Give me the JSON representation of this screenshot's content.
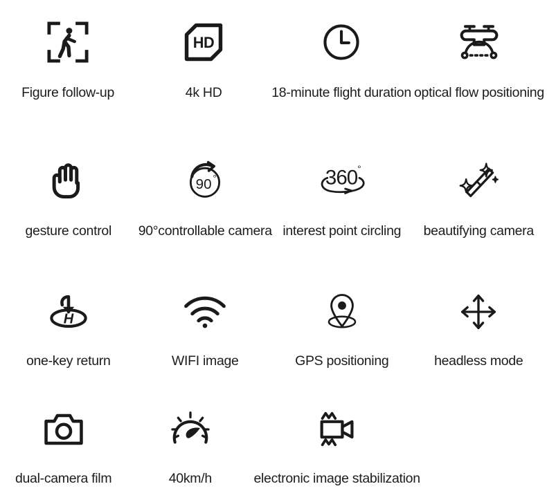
{
  "page": {
    "background_color": "#ffffff",
    "text_color": "#1c1c1c",
    "icon_color": "#1a1a1a",
    "columns": 4,
    "rows": 4
  },
  "rows": [
    {
      "items": [
        {
          "label": "Figure follow-up",
          "icon": "figure-follow-icon"
        },
        {
          "label": "4k HD",
          "icon": "hd-card-icon"
        },
        {
          "label": "18-minute flight duration",
          "icon": "clock-icon"
        },
        {
          "label": "optical flow positioning",
          "icon": "drone-optical-flow-icon"
        }
      ]
    },
    {
      "items": [
        {
          "label": "gesture control",
          "icon": "hand-icon"
        },
        {
          "label": "90°controllable camera",
          "icon": "ninety-degree-rotate-icon"
        },
        {
          "label": "interest point circling",
          "icon": "three-sixty-orbit-icon"
        },
        {
          "label": "beautifying camera",
          "icon": "magic-wand-sparkle-icon"
        }
      ]
    },
    {
      "items": [
        {
          "label": "one-key return",
          "icon": "return-to-home-icon"
        },
        {
          "label": "WIFI image",
          "icon": "wifi-icon"
        },
        {
          "label": "GPS positioning",
          "icon": "map-pin-icon"
        },
        {
          "label": "headless mode",
          "icon": "four-way-arrows-icon"
        }
      ]
    },
    {
      "items": [
        {
          "label": "dual-camera film",
          "icon": "camera-icon"
        },
        {
          "label": "40km/h",
          "icon": "speedometer-icon"
        },
        {
          "label": "electronic image stabilization",
          "icon": "video-camera-shake-icon"
        }
      ]
    }
  ],
  "icon_badges": {
    "hd_text": "HD",
    "degree_text": "90°",
    "orbit_text": "360",
    "orbit_degree": "°",
    "helipad_text": "H"
  }
}
